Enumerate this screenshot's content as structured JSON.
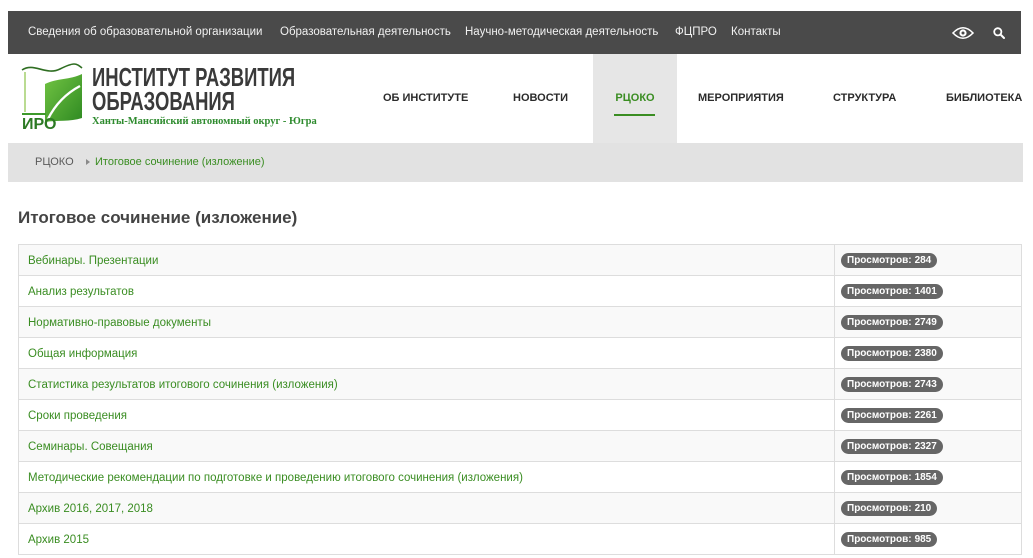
{
  "topbar": {
    "items": [
      "Сведения об образовательной организации",
      "Образовательная деятельность",
      "Научно-методическая деятельность",
      "ФЦПРО",
      "Контакты"
    ]
  },
  "icons": {
    "accessibility": "eye-icon",
    "search": "search-icon",
    "breadcrumb_separator": "caret-right-icon"
  },
  "logo": {
    "mark": "ИРО",
    "title_line1": "ИНСТИТУТ РАЗВИТИЯ",
    "title_line2": "ОБРАЗОВАНИЯ",
    "region": "Ханты-Мансийский автономный округ - Югра"
  },
  "nav": {
    "items": [
      "ОБ ИНСТИТУТЕ",
      "НОВОСТИ",
      "РЦОКО",
      "МЕРОПРИЯТИЯ",
      "СТРУКТУРА",
      "БИБЛИОТЕКА"
    ],
    "active_index": 2
  },
  "breadcrumb": {
    "items": [
      "РЦОКО",
      "Итоговое сочинение (изложение)"
    ]
  },
  "page": {
    "title": "Итоговое сочинение (изложение)"
  },
  "documents": {
    "views_label": "Просмотров:",
    "rows": [
      {
        "title": "Вебинары. Презентации",
        "views": 284
      },
      {
        "title": "Анализ результатов",
        "views": 1401
      },
      {
        "title": "Нормативно-правовые документы",
        "views": 2749
      },
      {
        "title": "Общая информация",
        "views": 2380
      },
      {
        "title": "Статистика результатов итогового сочинения (изложения)",
        "views": 2743
      },
      {
        "title": "Сроки проведения",
        "views": 2261
      },
      {
        "title": "Семинары. Совещания",
        "views": 2327
      },
      {
        "title": "Методические рекомендации по подготовке и проведению итогового сочинения (изложения)",
        "views": 1854
      },
      {
        "title": "Архив 2016, 2017, 2018",
        "views": 210
      },
      {
        "title": "Архив 2015",
        "views": 985
      }
    ]
  },
  "colors": {
    "topbar_bg": "#4a4a4a",
    "link": "#3a8d22",
    "active_nav_bg": "#e6e6e6",
    "breadcrumb_bg": "#e2e2e2",
    "badge_bg": "#666666",
    "heading": "#444444"
  }
}
